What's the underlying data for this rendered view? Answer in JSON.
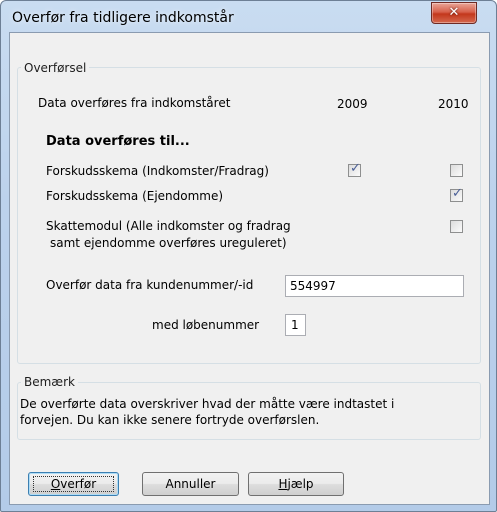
{
  "window": {
    "title": "Overfør fra tidligere indkomstår",
    "close_icon": "close-icon"
  },
  "transfer_group": {
    "legend": "Overførsel",
    "from_year_label": "Data overføres fra indkomståret",
    "year_1": "2009",
    "year_2": "2010",
    "to_heading": "Data overføres til...",
    "rows": [
      {
        "label": "Forskudsskema (Indkomster/Fradrag)",
        "checked_2009": true,
        "checked_2010": false
      },
      {
        "label": "Forskudsskema (Ejendomme)",
        "checked_2010": true
      },
      {
        "label_line1": "Skattemodul (Alle indkomster og fradrag",
        "label_line2": "samt ejendomme overføres ureguleret)",
        "checked_2010": false
      }
    ],
    "customer_label": "Overfør data fra kundenummer/-id",
    "customer_value": "554997",
    "serial_label": "med løbenummer",
    "serial_value": "1"
  },
  "remark_group": {
    "legend": "Bemærk",
    "line1": "De overførte data overskriver hvad der måtte være indtastet i",
    "line2": "forvejen. Du kan ikke senere fortryde overførslen."
  },
  "buttons": {
    "ok_accel": "O",
    "ok_rest": "verfør",
    "cancel": "Annuller",
    "help_accel": "H",
    "help_rest": "jælp"
  }
}
